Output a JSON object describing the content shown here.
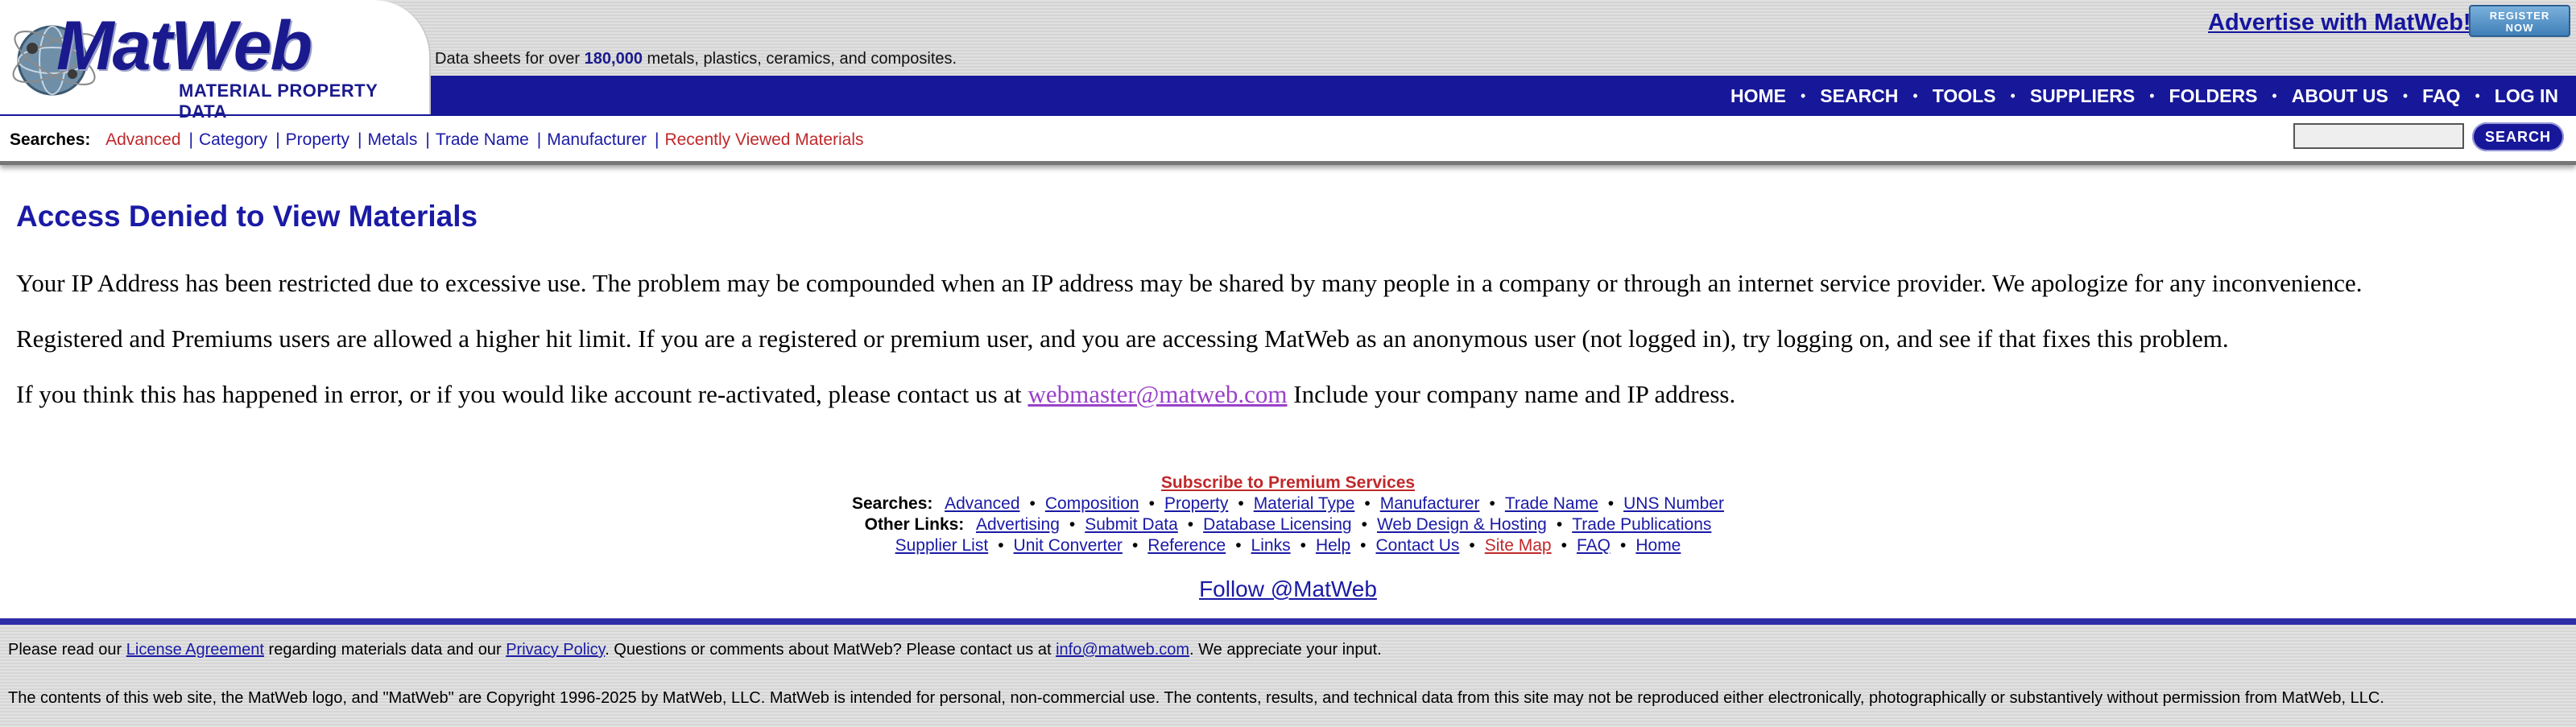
{
  "header": {
    "logo_text": "MatWeb",
    "logo_subtitle": "MATERIAL PROPERTY DATA",
    "tagline_pre": "Data sheets for over ",
    "tagline_count": "180,000",
    "tagline_post": " metals, plastics, ceramics, and composites.",
    "advertise_label": "Advertise with MatWeb!",
    "register_line1": "REGISTER",
    "register_line2": "NOW"
  },
  "nav": {
    "items": [
      "HOME",
      "SEARCH",
      "TOOLS",
      "SUPPLIERS",
      "FOLDERS",
      "ABOUT US",
      "FAQ",
      "LOG IN"
    ],
    "separator": "•"
  },
  "searches": {
    "label": "Searches:",
    "links": [
      "Advanced",
      "Category",
      "Property",
      "Metals",
      "Trade Name",
      "Manufacturer",
      "Recently Viewed Materials"
    ],
    "quick_search_value": "",
    "search_button": "SEARCH"
  },
  "main": {
    "title": "Access Denied to View Materials",
    "para1": "Your IP Address has been restricted due to excessive use. The problem may be compounded when an IP address may be shared by many people in a company or through an internet service provider. We apologize for any inconvenience.",
    "para2": "Registered and Premiums users are allowed a higher hit limit. If you are a registered or premium user, and you are accessing MatWeb as an anonymous user (not logged in), try logging on, and see if that fixes this problem.",
    "para3_pre": "If you think this has happened in error, or if you would like account re-activated, please contact us at ",
    "para3_email": "webmaster@matweb.com",
    "para3_post": " Include your company name and IP address."
  },
  "footer": {
    "subscribe": "Subscribe to Premium Services",
    "searches_label": "Searches:",
    "searches_links": [
      "Advanced",
      "Composition",
      "Property",
      "Material Type",
      "Manufacturer",
      "Trade Name",
      "UNS Number"
    ],
    "other_label": "Other Links:",
    "other_links": [
      "Advertising",
      "Submit Data",
      "Database Licensing",
      "Web Design & Hosting",
      "Trade Publications"
    ],
    "more_links": [
      "Supplier List",
      "Unit Converter",
      "Reference",
      "Links",
      "Help",
      "Contact Us",
      "Site Map",
      "FAQ",
      "Home"
    ],
    "follow": "Follow @MatWeb"
  },
  "bottom": {
    "line1_a": "Please read our ",
    "license_link": "License Agreement",
    "line1_b": " regarding materials data and our ",
    "privacy_link": "Privacy Policy",
    "line1_c": ". Questions or comments about MatWeb? Please contact us at ",
    "info_email": "info@matweb.com",
    "line1_d": ". We appreciate your input.",
    "copyright": "The contents of this web site, the MatWeb logo, and \"MatWeb\" are Copyright 1996-2025 by MatWeb, LLC. MatWeb is intended for personal, non-commercial use. The contents, results, and technical data from this site may not be reproduced either electronically, photographically or substantively without permission from MatWeb, LLC."
  },
  "colors": {
    "brand_blue": "#17179a",
    "link_blue": "#1a1aa6",
    "link_red": "#c0282a",
    "email_purple": "#9a42c8"
  }
}
